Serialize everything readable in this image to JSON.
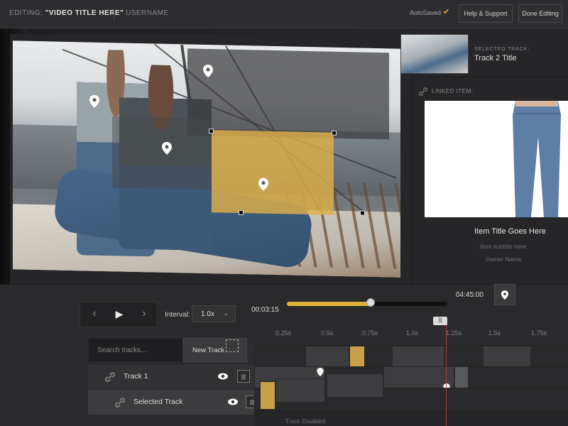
{
  "header": {
    "editing_prefix": "EDITING: ",
    "video_title": "\"VIDEO TITLE HERE\"",
    "username": "USERNAME",
    "autosaved": "AutoSaved",
    "help_label": "Help & Support",
    "done_label": "Done Editing"
  },
  "right_panel": {
    "selected_track_label": "SELECTED TRACK:",
    "selected_track_title": "Track 2 Title",
    "linked_item_label": "LINKED ITEM:",
    "item_title": "Item Title Goes Here",
    "item_subtitle": "Item subtitle here",
    "owner_name": "Owner Name"
  },
  "controls": {
    "interval_label": "Interval:",
    "interval_value": "1.0x",
    "time_current": "00:03:15",
    "time_total": "04:45:00",
    "progress": 0.52
  },
  "tracks": {
    "search_placeholder": "Search tracks...",
    "new_track_label": "New Track",
    "rows": [
      {
        "name": "Track 1"
      },
      {
        "name": "Selected Track"
      }
    ],
    "disabled_label": "Track Disabled"
  },
  "timeline": {
    "ticks": [
      "0.25s",
      "0.5s",
      "0.75s",
      "1.0s",
      "1.25s",
      "1.5s",
      "1.75s"
    ]
  },
  "colors": {
    "accent": "#e2b23a",
    "playhead": "#c0303a"
  }
}
